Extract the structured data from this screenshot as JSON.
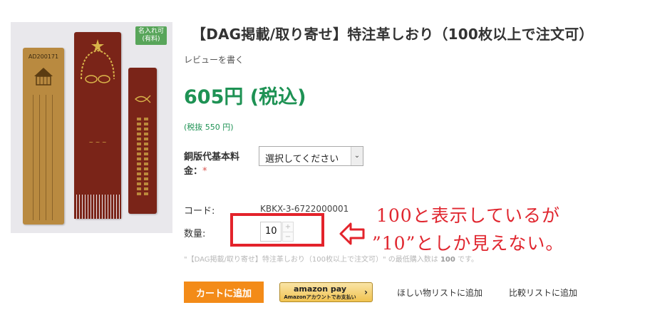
{
  "product": {
    "badge_line1": "名入れ可",
    "badge_line2": "(有料)",
    "bookmark_code": "AD200171",
    "title": "【DAG掲載/取り寄せ】特注革しおり（100枚以上で注文可）",
    "review_link": "レビューを書く",
    "price": "605円 (税込)",
    "price_excl_tax": "(税抜 550 円)"
  },
  "options": {
    "label": "銅版代基本料金：",
    "required_mark": "*",
    "select_value": "選択してください"
  },
  "details": {
    "code_label": "コード:",
    "code_value": "KBKX-3-6722000001",
    "qty_label": "数量:",
    "qty_value": "10",
    "stepper_up": "+",
    "stepper_down": "−"
  },
  "annotation": {
    "line1": "100と表示しているが",
    "line2": "”10”としか見えない。",
    "color": "#e0262f"
  },
  "min_note": {
    "prefix": "\"【DAG掲載/取り寄せ】特注革しおり（100枚以上で注文可）\" の最低購入数は ",
    "value": "100",
    "suffix": " です。"
  },
  "actions": {
    "cart_label": "カートに追加",
    "amazon_line1": "amazon pay",
    "amazon_line2": "Amazonアカウントでお支払い",
    "wishlist_label": "ほしい物リストに追加",
    "compare_label": "比較リストに追加"
  },
  "colors": {
    "price_green": "#1e9254",
    "cart_orange": "#f38b18",
    "highlight_red": "#e3232b"
  }
}
